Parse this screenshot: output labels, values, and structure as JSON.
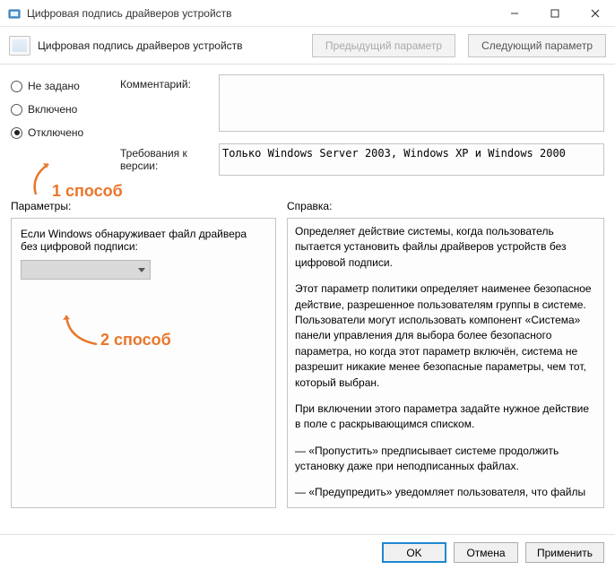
{
  "window": {
    "title": "Цифровая подпись драйверов устройств"
  },
  "header": {
    "title": "Цифровая подпись драйверов устройств",
    "prev_btn": "Предыдущий параметр",
    "next_btn": "Следующий параметр"
  },
  "state": {
    "options": {
      "not_configured": "Не задано",
      "enabled": "Включено",
      "disabled": "Отключено"
    },
    "selected": "disabled"
  },
  "fields": {
    "comment_label": "Комментарий:",
    "comment_value": "",
    "supported_label": "Требования к версии:",
    "supported_value": "Только Windows Server 2003, Windows XP и Windows 2000"
  },
  "section_labels": {
    "params": "Параметры:",
    "help": "Справка:"
  },
  "params": {
    "text": "Если Windows обнаруживает файл драйвера без цифровой подписи:"
  },
  "help": {
    "p1": "Определяет действие системы, когда пользователь пытается установить файлы драйверов устройств без цифровой подписи.",
    "p2": "Этот параметр политики определяет наименее безопасное действие, разрешенное пользователям группы в системе. Пользователи могут использовать компонент «Система» панели управления для выбора более безопасного параметра, но когда этот параметр включён, система не разрешит никакие менее безопасные параметры, чем тот, который выбран.",
    "p3": "При включении этого параметра задайте нужное действие в поле с раскрывающимся списком.",
    "p4": "— «Пропустить» предписывает системе продолжить установку даже при неподписанных файлах.",
    "p5": "— «Предупредить» уведомляет пользователя, что файлы не имеют цифровой подписи, и предоставляет пользователю"
  },
  "footer": {
    "ok": "OK",
    "cancel": "Отмена",
    "apply": "Применить"
  },
  "annotations": {
    "one": "1 способ",
    "two": "2 способ"
  },
  "colors": {
    "accent": "#1e88d2",
    "annotation": "#e9762b"
  }
}
